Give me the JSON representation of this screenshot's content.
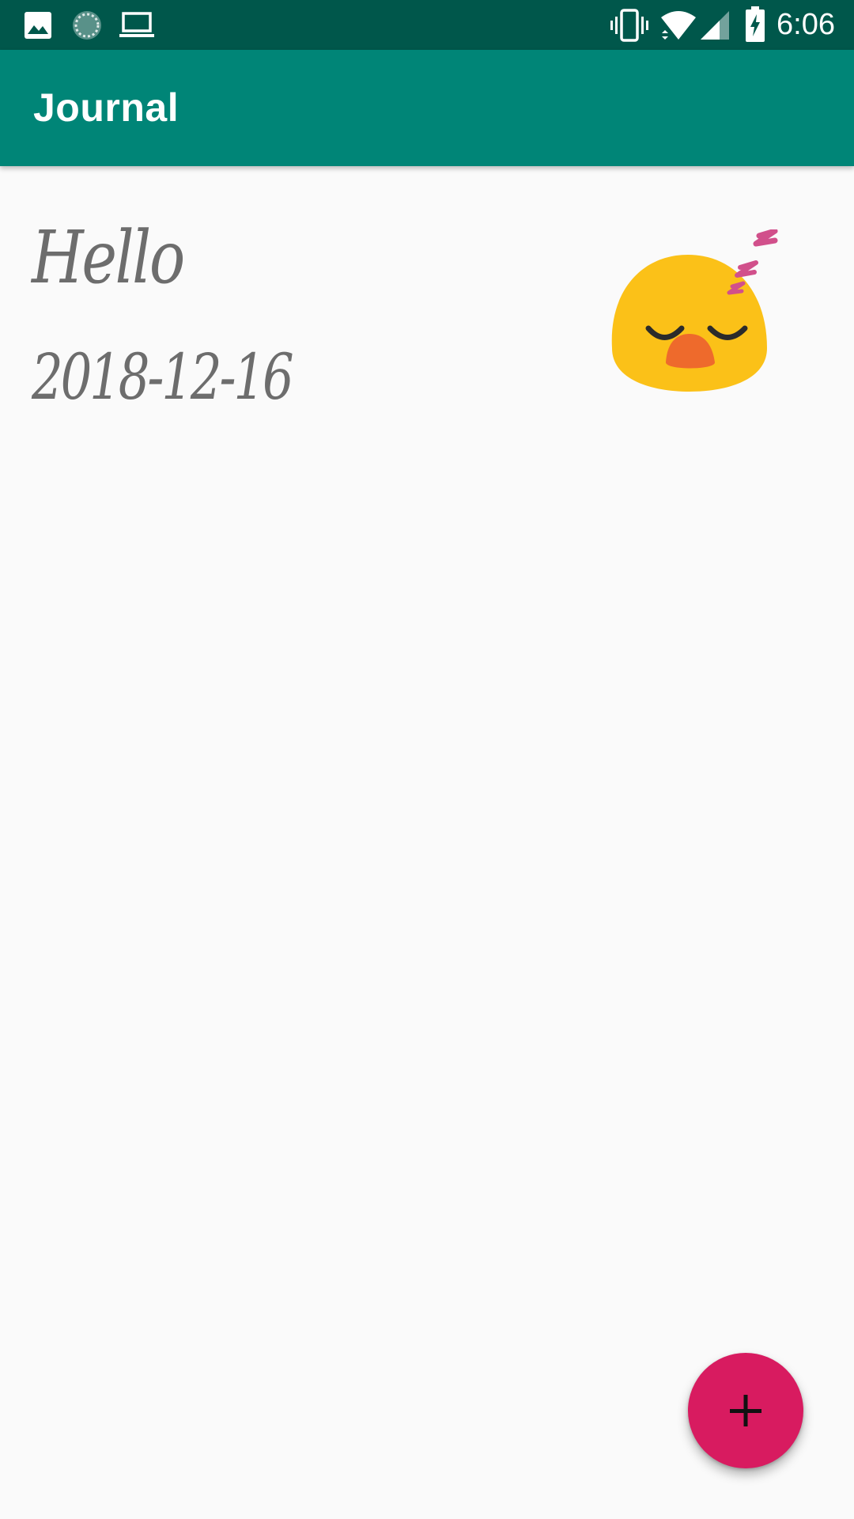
{
  "status_bar": {
    "time": "6:06",
    "left_icons": [
      "image-icon",
      "sync-icon",
      "laptop-icon"
    ],
    "right_icons": [
      "vibrate-icon",
      "wifi-icon",
      "signal-icon",
      "battery-charging-icon"
    ],
    "background": "#00574b"
  },
  "app_bar": {
    "title": "Journal",
    "background": "#008577"
  },
  "entries": [
    {
      "title": "Hello",
      "date": "2018-12-16",
      "mood_icon": "sleeping-face-icon"
    }
  ],
  "fab": {
    "icon": "plus-icon",
    "background": "#d81b60"
  }
}
